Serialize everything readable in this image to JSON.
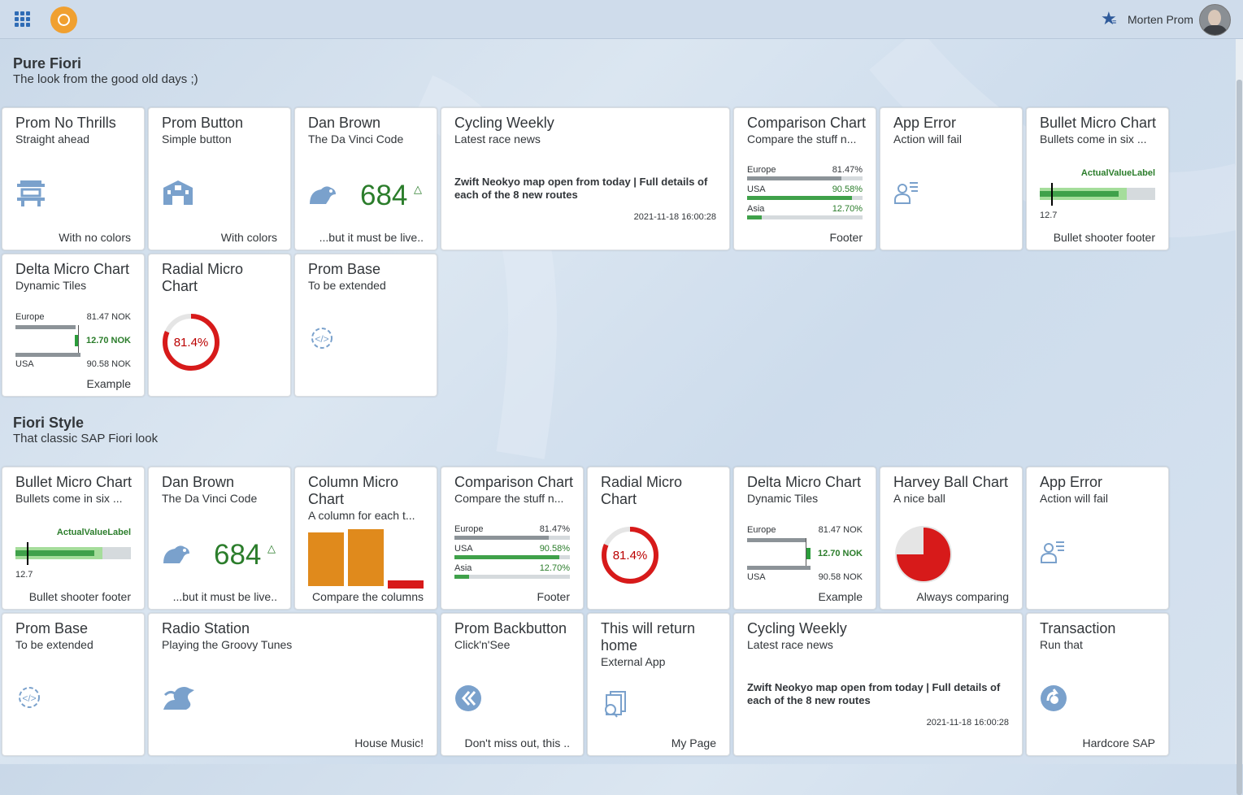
{
  "shell": {
    "user_name": "Morten Prom",
    "logo_icon": "sap-logo-icon",
    "grid_icon": "launchpad-grid-icon",
    "star_icon": "favorites-star-icon",
    "colors": {
      "accent": "#2f6cb5",
      "logo": "#f0a030"
    }
  },
  "sections": [
    {
      "title": "Pure Fiori",
      "subtitle": "The look from the good old days ;)"
    },
    {
      "title": "Fiori Style",
      "subtitle": "That classic SAP Fiori look"
    }
  ],
  "s1": {
    "no_thrills": {
      "title": "Prom No Thrills",
      "subtitle": "Straight ahead",
      "footer": "With no colors",
      "icon": "temple-icon"
    },
    "button": {
      "title": "Prom Button",
      "subtitle": "Simple button",
      "footer": "With colors",
      "icon": "building-icon"
    },
    "dan": {
      "title": "Dan Brown",
      "subtitle": "The Da Vinci Code",
      "kpi": "684",
      "trend": "△",
      "footer": "...but it must be live..",
      "icon": "rat-icon"
    },
    "cycling": {
      "title": "Cycling Weekly",
      "subtitle": "Latest race news",
      "news": "Zwift Neokyo map open from today | Full details of each of the 8 new routes",
      "date": "2021-11-18 16:00:28"
    },
    "comparison": {
      "title": "Comparison Chart",
      "subtitle": "Compare the stuff n...",
      "footer": "Footer",
      "rows": [
        {
          "label": "Europe",
          "value": "81.47%",
          "fraction": 0.8147,
          "color": "#8c9398"
        },
        {
          "label": "USA",
          "value": "90.58%",
          "fraction": 0.9058,
          "color": "#3fa14a"
        },
        {
          "label": "Asia",
          "value": "12.70%",
          "fraction": 0.127,
          "color": "#3fa14a"
        }
      ]
    },
    "app_error": {
      "title": "App Error",
      "subtitle": "Action will fail",
      "icon": "person-list-icon"
    },
    "bullet": {
      "title": "Bullet Micro Chart",
      "subtitle": "Bullets come in six ...",
      "label": "ActualValueLabel",
      "min": "12.7",
      "footer": "Bullet shooter footer",
      "target_fraction": 0.1,
      "value_fraction": 0.68,
      "range_fraction": 0.75
    },
    "delta": {
      "title": "Delta Micro Chart",
      "subtitle": "Dynamic Tiles",
      "label1": "Europe",
      "value1": "81.47 NOK",
      "label2": "USA",
      "value2": "90.58 NOK",
      "delta": "12.70 NOK",
      "footer": "Example"
    },
    "radial": {
      "title": "Radial Micro Chart",
      "value": "81.4%",
      "percent": 81.4,
      "color": "#d71a1a"
    },
    "base": {
      "title": "Prom Base",
      "subtitle": "To be extended",
      "icon": "gear-code-icon"
    }
  },
  "s2": {
    "bullet": {
      "title": "Bullet Micro Chart",
      "subtitle": "Bullets come in six ...",
      "label": "ActualValueLabel",
      "min": "12.7",
      "footer": "Bullet shooter footer",
      "target_fraction": 0.1,
      "value_fraction": 0.68,
      "range_fraction": 0.75
    },
    "dan": {
      "title": "Dan Brown",
      "subtitle": "The Da Vinci Code",
      "kpi": "684",
      "trend": "△",
      "footer": "...but it must be live..",
      "icon": "rat-icon"
    },
    "column": {
      "title": "Column Micro Chart",
      "subtitle": "A column for each t...",
      "footer": "Compare the columns",
      "columns": [
        0.95,
        1.0,
        -0.14
      ]
    },
    "comparison": {
      "title": "Comparison Chart",
      "subtitle": "Compare the stuff n...",
      "footer": "Footer",
      "rows": [
        {
          "label": "Europe",
          "value": "81.47%",
          "fraction": 0.8147,
          "color": "#8c9398"
        },
        {
          "label": "USA",
          "value": "90.58%",
          "fraction": 0.9058,
          "color": "#3fa14a"
        },
        {
          "label": "Asia",
          "value": "12.70%",
          "fraction": 0.127,
          "color": "#3fa14a"
        }
      ]
    },
    "radial": {
      "title": "Radial Micro Chart",
      "value": "81.4%",
      "percent": 81.4,
      "color": "#d71a1a"
    },
    "delta": {
      "title": "Delta Micro Chart",
      "subtitle": "Dynamic Tiles",
      "label1": "Europe",
      "value1": "81.47 NOK",
      "label2": "USA",
      "value2": "90.58 NOK",
      "delta": "12.70 NOK",
      "footer": "Example"
    },
    "harvey": {
      "title": "Harvey Ball Chart",
      "subtitle": "A nice ball",
      "footer": "Always comparing",
      "fraction": 0.75,
      "color": "#d71a1a"
    },
    "app_error": {
      "title": "App Error",
      "subtitle": "Action will fail",
      "icon": "person-list-icon"
    },
    "base": {
      "title": "Prom Base",
      "subtitle": "To be extended",
      "icon": "gear-code-icon"
    },
    "radio": {
      "title": "Radio Station",
      "subtitle": "Playing the Groovy Tunes",
      "footer": "House Music!",
      "icon": "dragon-icon"
    },
    "backbutton": {
      "title": "Prom Backbutton",
      "subtitle": "Click'n'See",
      "footer": "Don't miss out, this ..",
      "icon": "double-back-icon"
    },
    "return_home": {
      "title": "This will return home",
      "subtitle": "External App",
      "footer": "My Page",
      "icon": "documents-search-icon"
    },
    "cycling": {
      "title": "Cycling Weekly",
      "subtitle": "Latest race news",
      "news": "Zwift Neokyo map open from today | Full details of each of the 8 new routes",
      "date": "2021-11-18 16:00:28"
    },
    "transaction": {
      "title": "Transaction",
      "subtitle": "Run that",
      "footer": "Hardcore SAP",
      "icon": "sap-ui-icon"
    }
  }
}
